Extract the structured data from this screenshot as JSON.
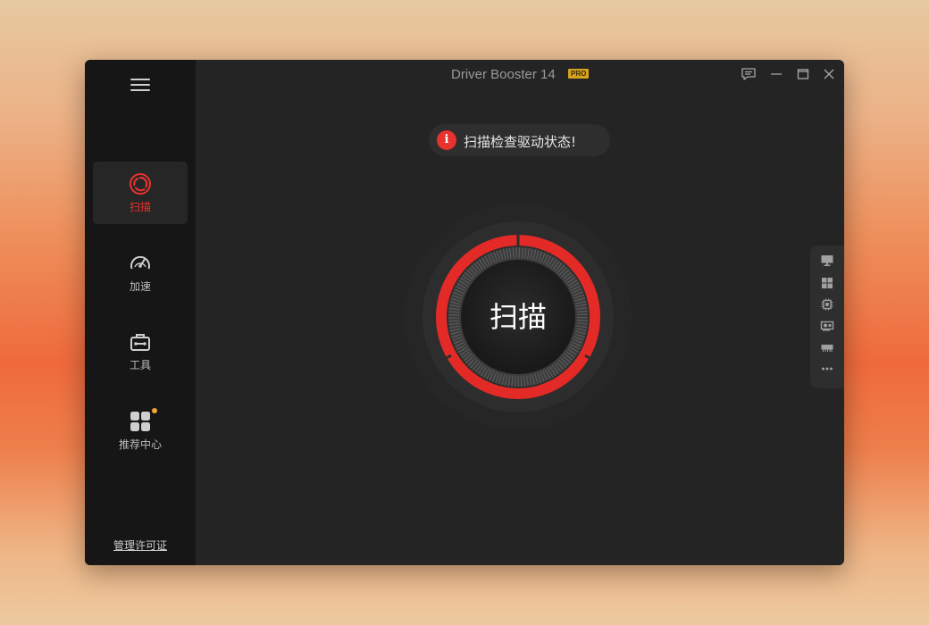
{
  "window": {
    "title": "Driver Booster 14",
    "edition_badge": "PRO"
  },
  "sidebar": {
    "items": [
      {
        "label": "扫描",
        "icon": "scan-icon",
        "active": true
      },
      {
        "label": "加速",
        "icon": "speedometer-icon",
        "active": false
      },
      {
        "label": "工具",
        "icon": "toolbox-icon",
        "active": false
      },
      {
        "label": "推荐中心",
        "icon": "apps-grid-icon",
        "active": false,
        "notification_dot": true
      }
    ],
    "license_link": "管理许可证"
  },
  "main": {
    "alert": {
      "icon": "info-icon",
      "icon_glyph": "i",
      "text": "扫描检查驱动状态!"
    },
    "scan_button": {
      "label": "扫描"
    }
  },
  "right_dock": {
    "items": [
      "monitor-icon",
      "windows-icon",
      "chip-icon",
      "graphics-card-icon",
      "memory-icon",
      "more-icon"
    ]
  },
  "colors": {
    "accent": "#e8322e",
    "window_bg": "#242424",
    "sidebar_bg": "#161616",
    "badge": "#d6a321",
    "notification": "#f2a531"
  }
}
